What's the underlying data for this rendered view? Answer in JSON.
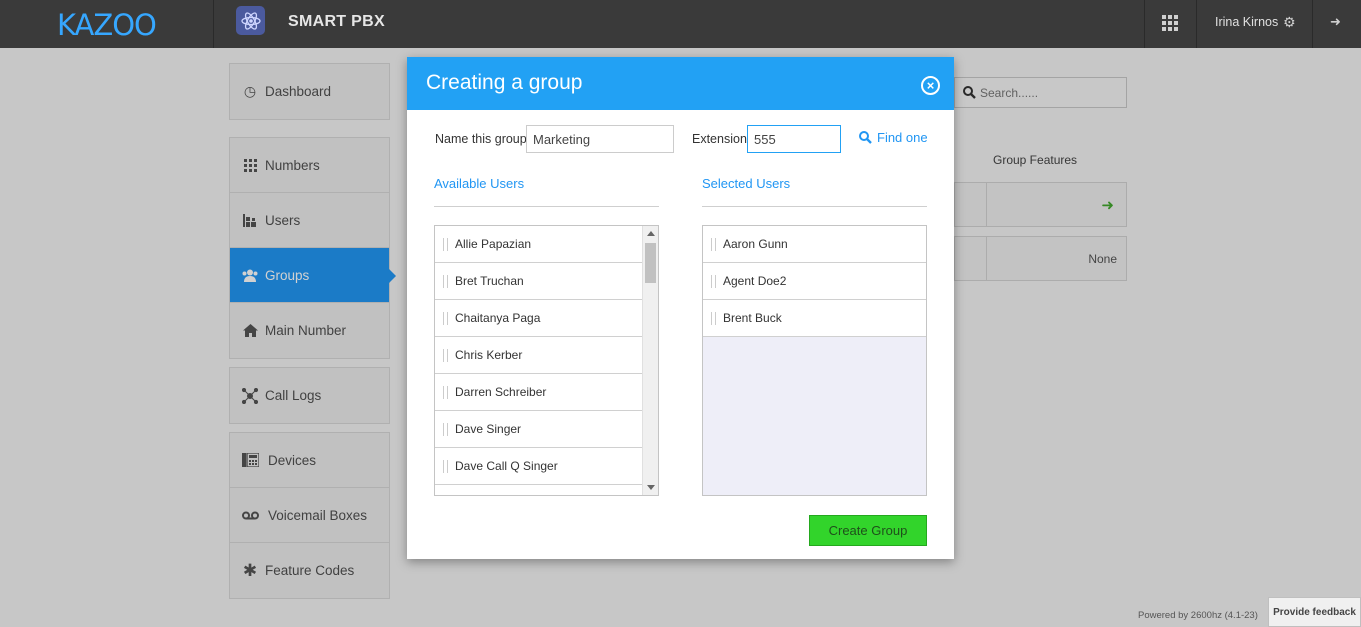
{
  "topbar": {
    "logo": "KAZOO",
    "app_title": "SMART PBX",
    "user_name": "Irina Kirnos"
  },
  "sidebar": {
    "groups": [
      [
        {
          "label": "Dashboard",
          "icon": "dashboard-icon"
        }
      ],
      [
        {
          "label": "Numbers",
          "icon": "grid-icon"
        },
        {
          "label": "Users",
          "icon": "users-icon"
        },
        {
          "label": "Groups",
          "icon": "group-icon",
          "active": true
        },
        {
          "label": "Main Number",
          "icon": "home-icon"
        }
      ],
      [
        {
          "label": "Call Logs",
          "icon": "network-icon"
        }
      ],
      [
        {
          "label": "Devices",
          "icon": "devices-icon"
        },
        {
          "label": "Voicemail Boxes",
          "icon": "voicemail-icon"
        },
        {
          "label": "Feature Codes",
          "icon": "asterisk-icon"
        }
      ]
    ]
  },
  "background": {
    "search_placeholder": "Search......",
    "group_features_header": "Group Features",
    "row2_value": "None"
  },
  "modal": {
    "title": "Creating a group",
    "name_label": "Name this group",
    "name_value": "Marketing",
    "extension_label": "Extension",
    "extension_value": "555",
    "find_one": "Find one",
    "available_title": "Available Users",
    "selected_title": "Selected Users",
    "available_users": [
      "Allie Papazian",
      "Bret Truchan",
      "Chaitanya Paga",
      "Chris Kerber",
      "Darren Schreiber",
      "Dave Singer",
      "Dave Call Q Singer"
    ],
    "selected_users": [
      "Aaron Gunn",
      "Agent Doe2",
      "Brent Buck"
    ],
    "create_button": "Create Group"
  },
  "footer": {
    "powered_by": "Powered by 2600hz  (4.1-23)",
    "feedback": "Provide feedback"
  },
  "colors": {
    "accent": "#22a1f4",
    "topbar": "#3a3a3a",
    "create_button": "#32d42b"
  }
}
